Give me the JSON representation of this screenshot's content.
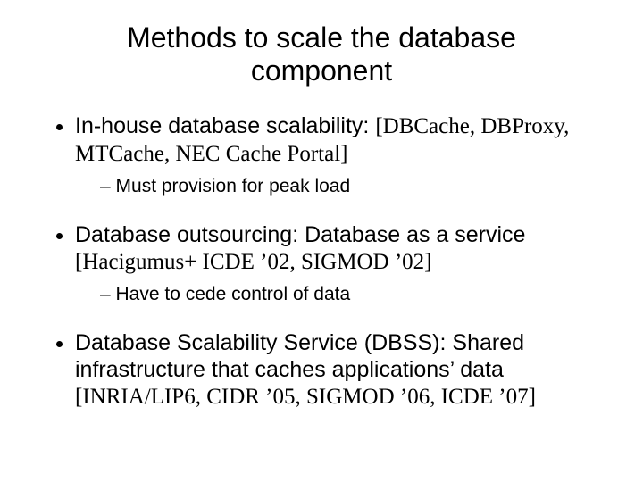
{
  "title_line1": "Methods to scale the database",
  "title_line2": "component",
  "bullets": [
    {
      "lead": "In-house database scalability: ",
      "ref": "[DBCache, DBProxy, MTCache, NEC Cache Portal]",
      "sub": "Must provision for peak load"
    },
    {
      "lead": "Database outsourcing: Database as a service ",
      "ref": "[Hacigumus+ ICDE ’02, SIGMOD ’02]",
      "sub": "Have to cede control of data"
    },
    {
      "lead": "Database Scalability Service (DBSS): Shared infrastructure that caches applications’ data ",
      "ref": "[INRIA/LIP6, CIDR ’05, SIGMOD ’06, ICDE ’07]",
      "sub": null
    }
  ]
}
